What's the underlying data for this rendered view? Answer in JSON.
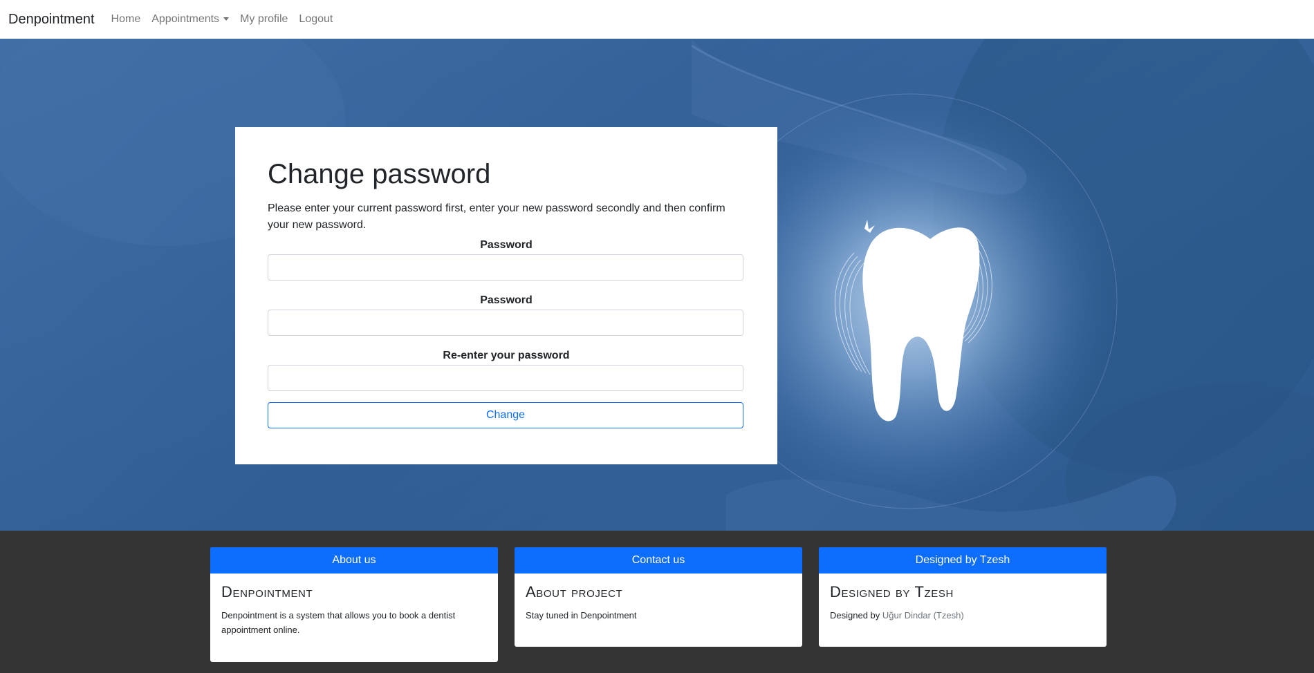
{
  "navbar": {
    "brand": "Denpointment",
    "links": [
      {
        "label": "Home"
      },
      {
        "label": "Appointments",
        "dropdown": true
      },
      {
        "label": "My profile"
      },
      {
        "label": "Logout"
      }
    ]
  },
  "form": {
    "title": "Change password",
    "description": "Please enter your current password first, enter your new password secondly and then confirm your new password.",
    "fields": [
      {
        "label": "Password",
        "value": ""
      },
      {
        "label": "Password",
        "value": ""
      },
      {
        "label": "Re-enter your password",
        "value": ""
      }
    ],
    "submit_label": "Change"
  },
  "footer": {
    "columns": [
      {
        "header": "About us",
        "title": "Denpointment",
        "text": "Denpointment is a system that allows you to book a dentist appointment online."
      },
      {
        "header": "Contact us",
        "title": "About project",
        "text": "Stay tuned in Denpointment"
      },
      {
        "header": "Designed by Tzesh",
        "title": "Designed by Tzesh",
        "text_prefix": "Designed by",
        "author_link": "Uğur Dindar (Tzesh)"
      }
    ]
  },
  "colors": {
    "primary": "#0d6efd",
    "hero_blue": "#2f5d95",
    "footer_bg": "#343434"
  }
}
